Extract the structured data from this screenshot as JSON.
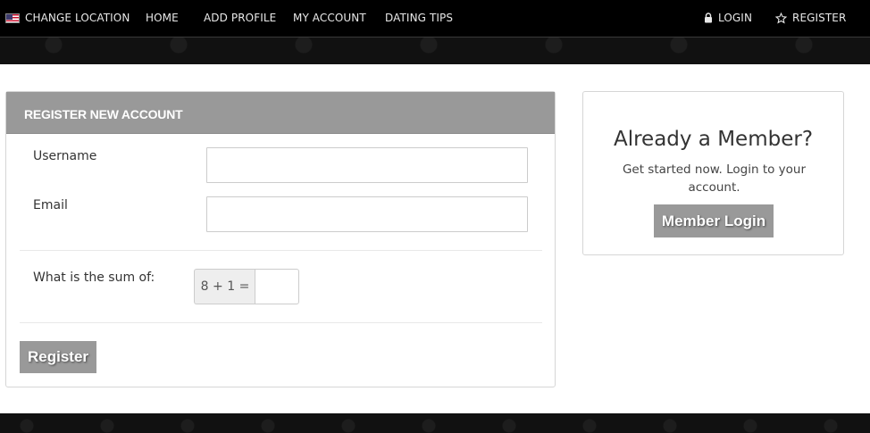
{
  "nav": {
    "change_location": "CHANGE LOCATION",
    "home": "HOME",
    "add_profile": "ADD PROFILE",
    "my_account": "MY ACCOUNT",
    "dating_tips": "DATING TIPS",
    "login": "LOGIN",
    "register": "REGISTER"
  },
  "register_form": {
    "title": "REGISTER NEW ACCOUNT",
    "username_label": "Username",
    "username_value": "",
    "email_label": "Email",
    "email_value": "",
    "captcha_label": "What is the sum of:",
    "captcha_question": "8 + 1 =",
    "captcha_value": "",
    "submit_label": "Register"
  },
  "member_box": {
    "title": "Already a Member?",
    "text": "Get started now. Login to your account.",
    "button_label": "Member Login"
  },
  "colors": {
    "header_bg": "#000000",
    "panel_header": "#999999",
    "button_bg": "#999999"
  }
}
